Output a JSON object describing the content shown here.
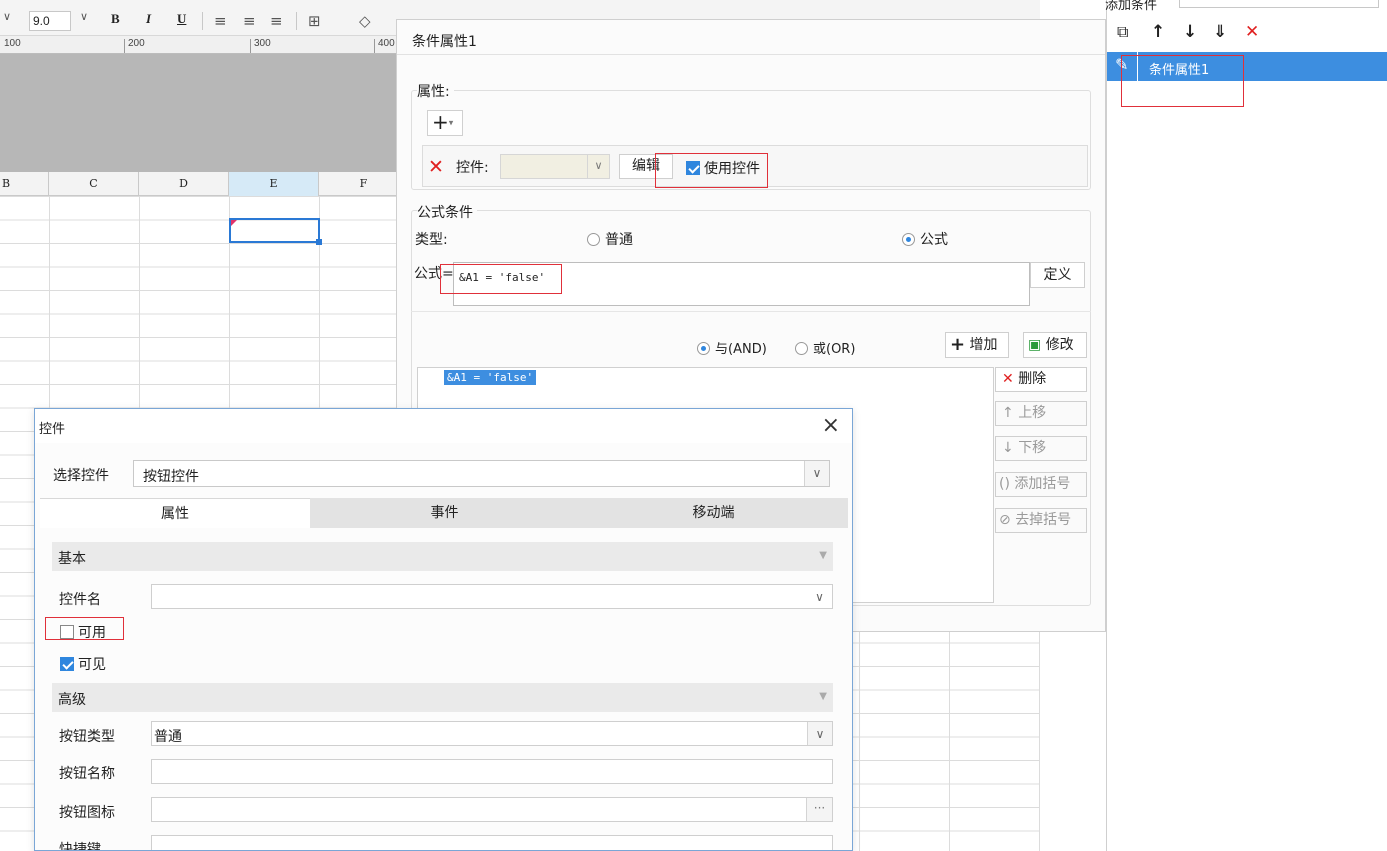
{
  "toolbar": {
    "font_size": "9.0",
    "bold": "B",
    "italic": "I",
    "underline": "U"
  },
  "ruler": {
    "marks": [
      "100",
      "200",
      "300",
      "400"
    ]
  },
  "sheet": {
    "columns": [
      "B",
      "C",
      "D",
      "E",
      "F"
    ]
  },
  "right_panel": {
    "top_label": "添加条件",
    "item_label": "条件属性1"
  },
  "cond_dialog": {
    "title": "条件属性1",
    "attr_group_label": "属性:",
    "control_label": "控件:",
    "edit_button": "编辑",
    "use_control_label": "使用控件",
    "formula_group_label": "公式条件",
    "type_label": "类型:",
    "radio_normal": "普通",
    "radio_formula": "公式",
    "formula_label": "公式=",
    "formula_value": "&A1 = 'false'",
    "define_button": "定义",
    "and_label": "与(AND)",
    "or_label": "或(OR)",
    "add_button": "增加",
    "modify_button": "修改",
    "list_item": "&A1 = 'false'",
    "delete_button": "删除",
    "up_button": "上移",
    "down_button": "下移",
    "add_bracket_button": "添加括号",
    "remove_bracket_button": "去掉括号"
  },
  "ctrl_dialog": {
    "title": "控件",
    "choose_label": "选择控件",
    "choose_value": "按钮控件",
    "tabs": [
      "属性",
      "事件",
      "移动端"
    ],
    "section_basic": "基本",
    "control_name_label": "控件名",
    "enabled_label": "可用",
    "visible_label": "可见",
    "section_advanced": "高级",
    "button_type_label": "按钮类型",
    "button_type_value": "普通",
    "button_name_label": "按钮名称",
    "button_icon_label": "按钮图标",
    "shortcut_label": "快捷键"
  },
  "colors": {
    "accent": "#3d8ee0",
    "highlight_box": "#e0303a",
    "delete_red": "#e02020"
  }
}
